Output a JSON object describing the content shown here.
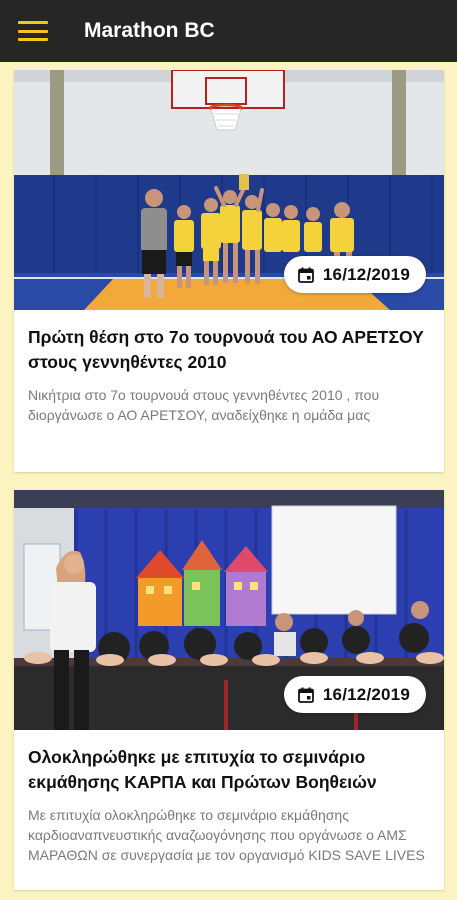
{
  "app_bar": {
    "title": "Marathon BC",
    "menu_icon": "hamburger-menu-icon",
    "accent_color": "#f5c518",
    "background_color": "#262626"
  },
  "background_color": "#fbf3c0",
  "news": [
    {
      "date": "16/12/2019",
      "title": "Πρώτη θέση στο 7ο τουρνουά του ΑΟ ΑΡΕΤΣΟΥ στους γεννηθέντες 2010",
      "description": "Νικήτρια στο 7ο τουρνουά στους γεννηθέντες 2010 , που διοργάνωσε ο ΑΟ ΑΡΕΤΣΟΥ, αναδείχθηκε η ομάδα μας"
    },
    {
      "date": "16/12/2019",
      "title": "Ολοκληρώθηκε με επιτυχία το σεμινάριο εκμάθησης ΚΑΡΠΑ και Πρώτων Βοηθειών",
      "description": "Με επιτυχία ολοκληρώθηκε το σεμινάριο εκμάθησης καρδιοαναπνευστικής αναζωογόνησης που οργάνωσε ο ΑΜΣ ΜΑΡΑΘΩΝ σε συνεργασία με τον οργανισμό KIDS SAVE LIVES"
    }
  ]
}
